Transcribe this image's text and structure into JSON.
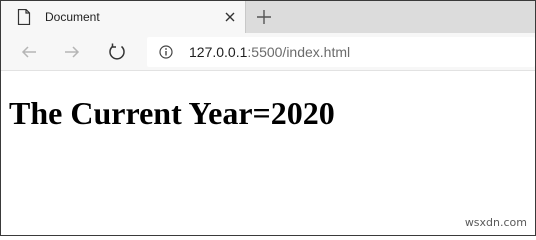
{
  "tab": {
    "title": "Document",
    "icon": "document-icon"
  },
  "toolbar": {
    "back_icon": "back-arrow-icon",
    "forward_icon": "forward-arrow-icon",
    "reload_icon": "reload-icon"
  },
  "address": {
    "host": "127.0.0.1",
    "rest": ":5500/index.html",
    "info_icon": "info-icon"
  },
  "page": {
    "heading": "The Current Year=2020"
  },
  "watermark": "wsxdn.com"
}
